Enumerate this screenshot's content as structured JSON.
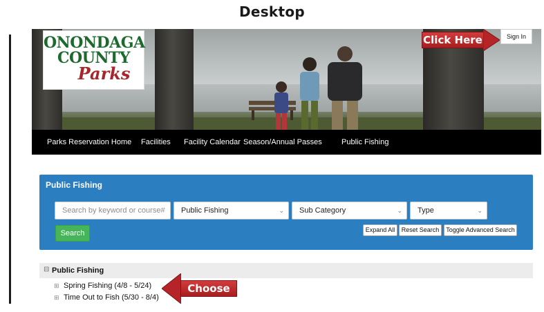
{
  "caption": "Desktop",
  "header": {
    "logo_line1": "ONONDAGA",
    "logo_line2": "COUNTY",
    "logo_line3": "Parks",
    "sign_in": "Sign In"
  },
  "callouts": {
    "sign_in_hint": "Click Here",
    "choose_hint": "Choose"
  },
  "nav": {
    "items": [
      "Parks Reservation Home",
      "Facilities",
      "Facility Calendar",
      "Season/Annual Passes",
      "Public Fishing"
    ]
  },
  "search_panel": {
    "title": "Public Fishing",
    "keyword_placeholder": "Search by keyword or course#",
    "category_value": "Public Fishing",
    "subcategory_value": "Sub Category",
    "type_value": "Type",
    "search_button": "Search",
    "expand_all": "Expand All",
    "reset_search": "Reset Search",
    "toggle_advanced": "Toggle Advanced Search"
  },
  "results": {
    "group_title": "Public Fishing",
    "items": [
      "Spring Fishing (4/8 - 5/24)",
      "Time Out to Fish (5/30 - 8/4)"
    ]
  },
  "colors": {
    "panel_blue": "#2b7fc1",
    "search_green": "#46b55a",
    "callout_red": "#b52528",
    "logo_green": "#1d6a2e",
    "logo_red": "#a8262b",
    "nav_black": "#000000"
  }
}
